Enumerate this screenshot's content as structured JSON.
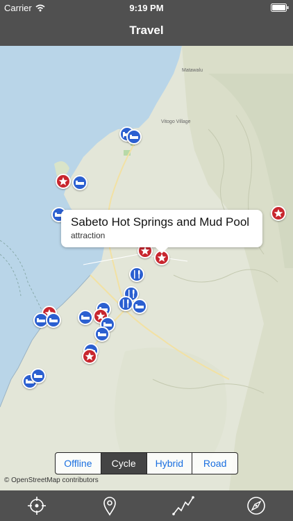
{
  "status_bar": {
    "carrier": "Carrier",
    "time": "9:19 PM"
  },
  "nav": {
    "title": "Travel"
  },
  "map": {
    "place_labels": [
      "Matawalu",
      "Vitogo Village"
    ],
    "callout": {
      "title": "Sabeto Hot Springs and Mud Pool",
      "subtitle": "attraction"
    },
    "marker_legend": {
      "blue_hotel": "hotel-icon",
      "blue_food": "restaurant-icon",
      "red_attraction": "star-icon"
    },
    "colors": {
      "water": "#b9d5e8",
      "land": "#e3e6d8",
      "hotel_marker": "#2b5fd0",
      "attraction_marker": "#c8262e"
    }
  },
  "map_type": {
    "options": [
      "Offline",
      "Cycle",
      "Hybrid",
      "Road"
    ],
    "selected": "Cycle"
  },
  "attribution": "© OpenStreetMap contributors",
  "toolbar": {
    "items": [
      "locate-icon",
      "pin-icon",
      "route-icon",
      "compass-icon"
    ]
  }
}
